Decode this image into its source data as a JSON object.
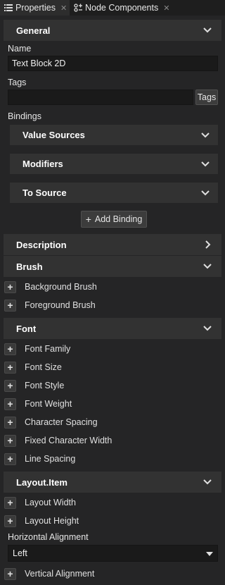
{
  "tabs": [
    {
      "label": "Properties",
      "icon": "list-icon",
      "active": true
    },
    {
      "label": "Node Components",
      "icon": "components-icon",
      "active": false
    }
  ],
  "general": {
    "title": "General",
    "name_label": "Name",
    "name_value": "Text Block 2D",
    "tags_label": "Tags",
    "tags_value": "",
    "tags_button": "Tags",
    "bindings_label": "Bindings",
    "value_sources": "Value Sources",
    "modifiers": "Modifiers",
    "to_source": "To Source",
    "add_binding": "Add Binding"
  },
  "description": {
    "title": "Description"
  },
  "brush": {
    "title": "Brush",
    "items": [
      "Background Brush",
      "Foreground Brush"
    ]
  },
  "font": {
    "title": "Font",
    "items": [
      "Font Family",
      "Font Size",
      "Font Style",
      "Font Weight",
      "Character Spacing",
      "Fixed Character Width",
      "Line Spacing"
    ]
  },
  "layout_item": {
    "title": "Layout.Item",
    "items": [
      "Layout Width",
      "Layout Height"
    ],
    "horizontal_alignment_label": "Horizontal Alignment",
    "horizontal_alignment_value": "Left",
    "vertical_alignment": "Vertical Alignment"
  },
  "colors": {
    "background": "#252526",
    "section_header": "#323232",
    "input_bg": "#1a1a1a",
    "text": "#e0e0e0"
  }
}
